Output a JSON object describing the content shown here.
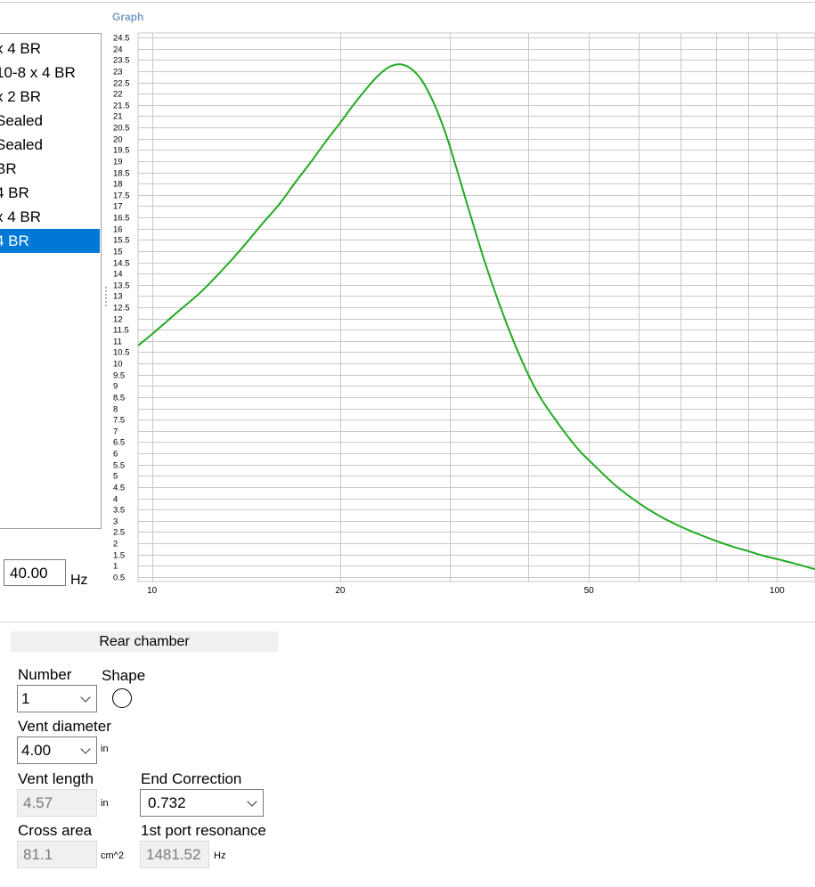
{
  "graph": {
    "title": "Graph",
    "line_color": "#22aa22",
    "grid_color": "#c8c8c8"
  },
  "list": {
    "items": [
      {
        "label": "x 4 BR",
        "selected": false
      },
      {
        "label": "10-8 x 4 BR",
        "selected": false
      },
      {
        "label": "x 2 BR",
        "selected": false
      },
      {
        "label": "Sealed",
        "selected": false
      },
      {
        "label": "Sealed",
        "selected": false
      },
      {
        "label": "BR",
        "selected": false
      },
      {
        "label": "4 BR",
        "selected": false
      },
      {
        "label": "x 4 BR",
        "selected": false
      },
      {
        "label": "4 BR",
        "selected": true
      }
    ],
    "selection_color": "#0078d7"
  },
  "frequency": {
    "value": "40.00",
    "unit": "Hz"
  },
  "rear_chamber": {
    "title": "Rear chamber",
    "number_label": "Number",
    "number_value": "1",
    "shape_label": "Shape",
    "shape_icon": "circle-shape-icon",
    "vent_diameter_label": "Vent diameter",
    "vent_diameter_value": "4.00",
    "vent_diameter_unit": "in",
    "vent_length_label": "Vent length",
    "vent_length_value": "4.57",
    "vent_length_unit": "in",
    "end_correction_label": "End Correction",
    "end_correction_value": "0.732",
    "cross_area_label": "Cross area",
    "cross_area_value": "81.1",
    "cross_area_unit": "cm^2",
    "port_resonance_label": "1st port resonance",
    "port_resonance_value": "1481.52",
    "port_resonance_unit": "Hz"
  },
  "chart_data": {
    "type": "line",
    "x_scale": "log",
    "xlim": [
      9.5,
      115
    ],
    "ylim": [
      0.3,
      24.7
    ],
    "x_ticks": [
      10,
      20,
      50,
      100
    ],
    "x_gridlines": [
      10,
      20,
      30,
      40,
      50,
      60,
      70,
      80,
      90,
      100
    ],
    "y_ticks": [
      0.5,
      1,
      1.5,
      2,
      2.5,
      3,
      3.5,
      4,
      4.5,
      5,
      5.5,
      6,
      6.5,
      7,
      7.5,
      8,
      8.5,
      9,
      9.5,
      10,
      10.5,
      11,
      11.5,
      12,
      12.5,
      13,
      13.5,
      14,
      14.5,
      15,
      15.5,
      16,
      16.5,
      17,
      17.5,
      18,
      18.5,
      19,
      19.5,
      20,
      20.5,
      21,
      21.5,
      22,
      22.5,
      23,
      23.5,
      24,
      24.5
    ],
    "grid": true,
    "series": [
      {
        "x": [
          9.5,
          10,
          11,
          12,
          13,
          14,
          15,
          16,
          17,
          18,
          19,
          20,
          21,
          22,
          23,
          24,
          25,
          26,
          27,
          28,
          29,
          30,
          32,
          34,
          36,
          38,
          40,
          42,
          45,
          48,
          50,
          55,
          60,
          65,
          70,
          75,
          80,
          85,
          90,
          95,
          100,
          105,
          110,
          115
        ],
        "y": [
          10.8,
          11.3,
          12.3,
          13.2,
          14.2,
          15.2,
          16.2,
          17.1,
          18.1,
          19.0,
          19.9,
          20.7,
          21.5,
          22.2,
          22.8,
          23.2,
          23.3,
          23.1,
          22.6,
          21.8,
          20.8,
          19.6,
          17.0,
          14.6,
          12.6,
          10.9,
          9.5,
          8.4,
          7.2,
          6.2,
          5.7,
          4.6,
          3.8,
          3.2,
          2.75,
          2.4,
          2.1,
          1.85,
          1.65,
          1.45,
          1.3,
          1.15,
          1.0,
          0.85
        ]
      }
    ]
  }
}
